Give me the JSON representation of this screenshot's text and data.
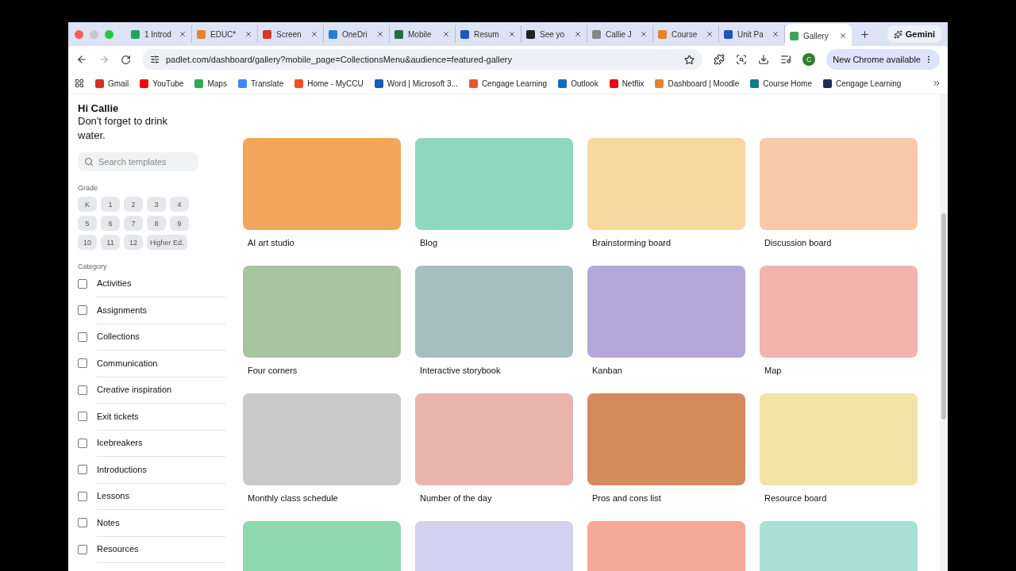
{
  "tabs": [
    {
      "title": "1 Introd",
      "color": "#1fa463",
      "selected": false
    },
    {
      "title": "EDUC*",
      "color": "#e8822a",
      "selected": false
    },
    {
      "title": "Screen",
      "color": "#d9342b",
      "selected": false
    },
    {
      "title": "OneDri",
      "color": "#2b7cd3",
      "selected": false
    },
    {
      "title": "Mobile",
      "color": "#1e7145",
      "selected": false
    },
    {
      "title": "Resum",
      "color": "#185abd",
      "selected": false
    },
    {
      "title": "See yo",
      "color": "#222222",
      "selected": false
    },
    {
      "title": "Callie J",
      "color": "#888888",
      "selected": false
    },
    {
      "title": "Course",
      "color": "#e8822a",
      "selected": false
    },
    {
      "title": "Unit Pa",
      "color": "#185abd",
      "selected": false
    },
    {
      "title": "Gallery",
      "color": "#3aa655",
      "selected": true
    }
  ],
  "gemini": "Gemini",
  "address": "padlet.com/dashboard/gallery?mobile_page=CollectionsMenu&audience=featured-gallery",
  "profile_initial": "C",
  "update_button": "New Chrome available",
  "bookmarks": [
    {
      "label": "Gmail",
      "color": "#d93025"
    },
    {
      "label": "YouTube",
      "color": "#ff0000"
    },
    {
      "label": "Maps",
      "color": "#34a853"
    },
    {
      "label": "Translate",
      "color": "#4285f4"
    },
    {
      "label": "Home - MyCCU",
      "color": "#f25022"
    },
    {
      "label": "Word | Microsoft 3...",
      "color": "#185abd"
    },
    {
      "label": "Cengage Learning",
      "color": "#e8582a"
    },
    {
      "label": "Outlook",
      "color": "#0f6cbd"
    },
    {
      "label": "Netflix",
      "color": "#e50914"
    },
    {
      "label": "Dashboard | Moodle",
      "color": "#e8822a"
    },
    {
      "label": "Course Home",
      "color": "#0f7c8c"
    },
    {
      "label": "Cengage Learning",
      "color": "#1d2b5c"
    }
  ],
  "sidebar": {
    "greeting": "Hi Callie",
    "message": "Don't forget to drink water.",
    "search": {
      "placeholder": "Search templates"
    },
    "grade_label": "Grade",
    "grades": [
      "K",
      "1",
      "2",
      "3",
      "4",
      "5",
      "6",
      "7",
      "8",
      "9",
      "10",
      "11",
      "12",
      "Higher Ed."
    ],
    "category_label": "Category",
    "categories": [
      {
        "label": "Activities",
        "checked": false
      },
      {
        "label": "Assignments",
        "checked": false
      },
      {
        "label": "Collections",
        "checked": false
      },
      {
        "label": "Communication",
        "checked": false
      },
      {
        "label": "Creative inspiration",
        "checked": false
      },
      {
        "label": "Exit tickets",
        "checked": false
      },
      {
        "label": "Icebreakers",
        "checked": false
      },
      {
        "label": "Introductions",
        "checked": false
      },
      {
        "label": "Lessons",
        "checked": false
      },
      {
        "label": "Notes",
        "checked": false
      },
      {
        "label": "Resources",
        "checked": false
      }
    ]
  },
  "templates": [
    {
      "title": "AI art studio",
      "color": "#f2a65a"
    },
    {
      "title": "Blog",
      "color": "#8fd8c0"
    },
    {
      "title": "Brainstorming board",
      "color": "#f7d9a0"
    },
    {
      "title": "Discussion board",
      "color": "#f6c9a8"
    },
    {
      "title": "Four corners",
      "color": "#a9c4a0"
    },
    {
      "title": "Interactive storybook",
      "color": "#a8bfc2"
    },
    {
      "title": "Kanban",
      "color": "#b4a7d9"
    },
    {
      "title": "Map",
      "color": "#f4b4ae"
    },
    {
      "title": "Monthly class schedule",
      "color": "#c9c9c9"
    },
    {
      "title": "Number of the day",
      "color": "#e8b4ac"
    },
    {
      "title": "Pros and cons list",
      "color": "#d48a5a"
    },
    {
      "title": "Resource board",
      "color": "#f3e3a6"
    },
    {
      "color": "#8fd8b0"
    },
    {
      "color": "#d4d0f0"
    },
    {
      "color": "#f4a898"
    },
    {
      "color": "#a8e0d4"
    }
  ]
}
